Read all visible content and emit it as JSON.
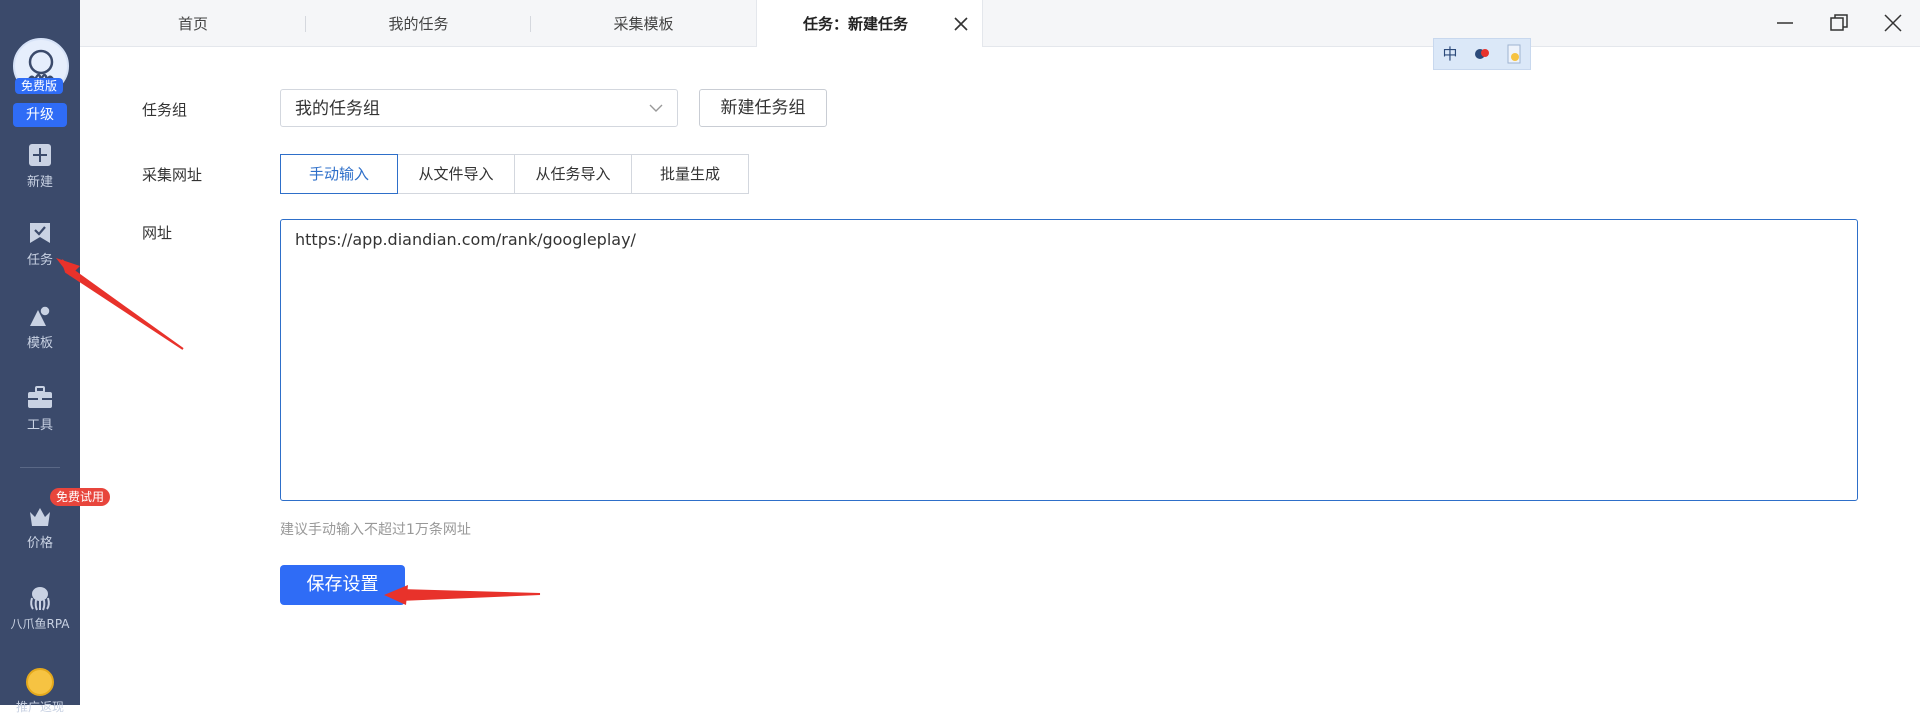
{
  "sidebar": {
    "free_tag": "免费版",
    "upgrade": "升级",
    "items": [
      {
        "label": "新建",
        "icon": "plus-square-icon"
      },
      {
        "label": "任务",
        "icon": "task-check-icon"
      },
      {
        "label": "模板",
        "icon": "template-shapes-icon"
      },
      {
        "label": "工具",
        "icon": "toolbox-icon"
      },
      {
        "label": "价格",
        "icon": "crown-basket-icon"
      },
      {
        "label": "八爪鱼RPA",
        "icon": "octopus-icon"
      }
    ],
    "trial_badge": "免费试用",
    "coin_label": "推广返现"
  },
  "tabs": [
    {
      "label": "首页"
    },
    {
      "label": "我的任务"
    },
    {
      "label": "采集模板"
    },
    {
      "label": "任务：新建任务",
      "active": true
    }
  ],
  "ime": {
    "mode": "中"
  },
  "form": {
    "group_label": "任务组",
    "group_value": "我的任务组",
    "new_group_button": "新建任务组",
    "url_source_label": "采集网址",
    "source_options": [
      "手动输入",
      "从文件导入",
      "从任务导入",
      "批量生成"
    ],
    "url_label": "网址",
    "url_value": "https://app.diandian.com/rank/googleplay/",
    "hint": "建议手动输入不超过1万条网址",
    "save_button": "保存设置"
  },
  "colors": {
    "accent": "#2f6cf6",
    "sidebar": "#3b4a6b",
    "annotation": "#e8322b",
    "badge": "#e8453c"
  }
}
